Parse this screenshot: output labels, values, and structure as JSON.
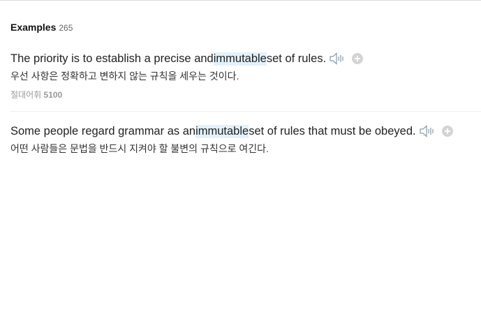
{
  "header": {
    "title": "Examples",
    "count": "265"
  },
  "examples": [
    {
      "en_before": "The priority is to establish a precise and ",
      "en_highlight": "immutable",
      "en_after": " set of rules.",
      "ko": "우선 사항은 정확하고 변하지 않는 규칙을 세우는 것이다.",
      "source_name": "절대어휘",
      "source_num": "5100"
    },
    {
      "en_before": "Some people regard grammar as an ",
      "en_highlight": "immutable",
      "en_after": " set of rules that must be obeyed.",
      "ko": "어떤 사람들은 문법을 반드시 지켜야 할 불변의 규칙으로 여긴다."
    }
  ],
  "icons": {
    "speaker": "speaker-icon",
    "add": "plus-circle-icon"
  },
  "colors": {
    "highlight": "#e3f1fb",
    "icon_gray": "#8a9aa6"
  }
}
